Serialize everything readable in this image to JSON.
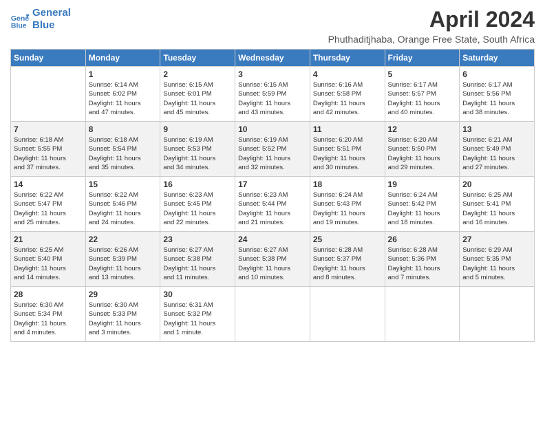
{
  "logo": {
    "line1": "General",
    "line2": "Blue"
  },
  "title": "April 2024",
  "subtitle": "Phuthaditjhaba, Orange Free State, South Africa",
  "days_of_week": [
    "Sunday",
    "Monday",
    "Tuesday",
    "Wednesday",
    "Thursday",
    "Friday",
    "Saturday"
  ],
  "weeks": [
    [
      {
        "num": "",
        "info": ""
      },
      {
        "num": "1",
        "info": "Sunrise: 6:14 AM\nSunset: 6:02 PM\nDaylight: 11 hours\nand 47 minutes."
      },
      {
        "num": "2",
        "info": "Sunrise: 6:15 AM\nSunset: 6:01 PM\nDaylight: 11 hours\nand 45 minutes."
      },
      {
        "num": "3",
        "info": "Sunrise: 6:15 AM\nSunset: 5:59 PM\nDaylight: 11 hours\nand 43 minutes."
      },
      {
        "num": "4",
        "info": "Sunrise: 6:16 AM\nSunset: 5:58 PM\nDaylight: 11 hours\nand 42 minutes."
      },
      {
        "num": "5",
        "info": "Sunrise: 6:17 AM\nSunset: 5:57 PM\nDaylight: 11 hours\nand 40 minutes."
      },
      {
        "num": "6",
        "info": "Sunrise: 6:17 AM\nSunset: 5:56 PM\nDaylight: 11 hours\nand 38 minutes."
      }
    ],
    [
      {
        "num": "7",
        "info": "Sunrise: 6:18 AM\nSunset: 5:55 PM\nDaylight: 11 hours\nand 37 minutes."
      },
      {
        "num": "8",
        "info": "Sunrise: 6:18 AM\nSunset: 5:54 PM\nDaylight: 11 hours\nand 35 minutes."
      },
      {
        "num": "9",
        "info": "Sunrise: 6:19 AM\nSunset: 5:53 PM\nDaylight: 11 hours\nand 34 minutes."
      },
      {
        "num": "10",
        "info": "Sunrise: 6:19 AM\nSunset: 5:52 PM\nDaylight: 11 hours\nand 32 minutes."
      },
      {
        "num": "11",
        "info": "Sunrise: 6:20 AM\nSunset: 5:51 PM\nDaylight: 11 hours\nand 30 minutes."
      },
      {
        "num": "12",
        "info": "Sunrise: 6:20 AM\nSunset: 5:50 PM\nDaylight: 11 hours\nand 29 minutes."
      },
      {
        "num": "13",
        "info": "Sunrise: 6:21 AM\nSunset: 5:49 PM\nDaylight: 11 hours\nand 27 minutes."
      }
    ],
    [
      {
        "num": "14",
        "info": "Sunrise: 6:22 AM\nSunset: 5:47 PM\nDaylight: 11 hours\nand 25 minutes."
      },
      {
        "num": "15",
        "info": "Sunrise: 6:22 AM\nSunset: 5:46 PM\nDaylight: 11 hours\nand 24 minutes."
      },
      {
        "num": "16",
        "info": "Sunrise: 6:23 AM\nSunset: 5:45 PM\nDaylight: 11 hours\nand 22 minutes."
      },
      {
        "num": "17",
        "info": "Sunrise: 6:23 AM\nSunset: 5:44 PM\nDaylight: 11 hours\nand 21 minutes."
      },
      {
        "num": "18",
        "info": "Sunrise: 6:24 AM\nSunset: 5:43 PM\nDaylight: 11 hours\nand 19 minutes."
      },
      {
        "num": "19",
        "info": "Sunrise: 6:24 AM\nSunset: 5:42 PM\nDaylight: 11 hours\nand 18 minutes."
      },
      {
        "num": "20",
        "info": "Sunrise: 6:25 AM\nSunset: 5:41 PM\nDaylight: 11 hours\nand 16 minutes."
      }
    ],
    [
      {
        "num": "21",
        "info": "Sunrise: 6:25 AM\nSunset: 5:40 PM\nDaylight: 11 hours\nand 14 minutes."
      },
      {
        "num": "22",
        "info": "Sunrise: 6:26 AM\nSunset: 5:39 PM\nDaylight: 11 hours\nand 13 minutes."
      },
      {
        "num": "23",
        "info": "Sunrise: 6:27 AM\nSunset: 5:38 PM\nDaylight: 11 hours\nand 11 minutes."
      },
      {
        "num": "24",
        "info": "Sunrise: 6:27 AM\nSunset: 5:38 PM\nDaylight: 11 hours\nand 10 minutes."
      },
      {
        "num": "25",
        "info": "Sunrise: 6:28 AM\nSunset: 5:37 PM\nDaylight: 11 hours\nand 8 minutes."
      },
      {
        "num": "26",
        "info": "Sunrise: 6:28 AM\nSunset: 5:36 PM\nDaylight: 11 hours\nand 7 minutes."
      },
      {
        "num": "27",
        "info": "Sunrise: 6:29 AM\nSunset: 5:35 PM\nDaylight: 11 hours\nand 5 minutes."
      }
    ],
    [
      {
        "num": "28",
        "info": "Sunrise: 6:30 AM\nSunset: 5:34 PM\nDaylight: 11 hours\nand 4 minutes."
      },
      {
        "num": "29",
        "info": "Sunrise: 6:30 AM\nSunset: 5:33 PM\nDaylight: 11 hours\nand 3 minutes."
      },
      {
        "num": "30",
        "info": "Sunrise: 6:31 AM\nSunset: 5:32 PM\nDaylight: 11 hours\nand 1 minute."
      },
      {
        "num": "",
        "info": ""
      },
      {
        "num": "",
        "info": ""
      },
      {
        "num": "",
        "info": ""
      },
      {
        "num": "",
        "info": ""
      }
    ]
  ]
}
